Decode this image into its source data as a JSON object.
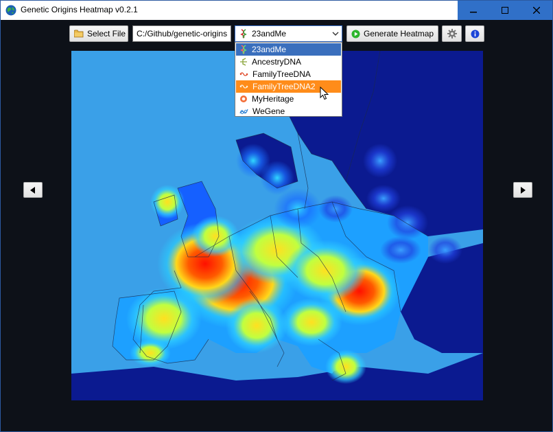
{
  "window": {
    "title": "Genetic Origins Heatmap v0.2.1",
    "icon": "globe-icon",
    "controls": [
      "minimize-icon",
      "maximize-icon",
      "close-icon"
    ]
  },
  "toolbar": {
    "select_file_label": "Select File",
    "file_path": "C:/Github/genetic-origins",
    "provider_selected": "23andMe",
    "generate_label": "Generate Heatmap",
    "settings_icon": "gear-icon",
    "info_icon": "info-icon"
  },
  "provider_dropdown": {
    "items": [
      {
        "label": "23andMe",
        "icon": "23andme-dna-icon",
        "state": "selected"
      },
      {
        "label": "AncestryDNA",
        "icon": "ancestry-leaf-icon",
        "state": "normal"
      },
      {
        "label": "FamilyTreeDNA",
        "icon": "ftdna-icon",
        "state": "normal"
      },
      {
        "label": "FamilyTreeDNA2",
        "icon": "ftdna-icon",
        "state": "hover"
      },
      {
        "label": "MyHeritage",
        "icon": "myheritage-icon",
        "state": "normal"
      },
      {
        "label": "WeGene",
        "icon": "wegene-icon",
        "state": "normal"
      }
    ]
  },
  "navigation": {
    "prev_icon": "arrow-left-icon",
    "next_icon": "arrow-right-icon"
  },
  "heatmap": {
    "region": "Europe",
    "colors": {
      "ocean": "#3aa0e8",
      "land_cold": "#0a1a8a",
      "mid": "#1aa0ff",
      "warm": "#ffe020",
      "hot": "#ff1010"
    }
  },
  "colors": {
    "title_bar_controls": "#3070c8",
    "dropdown_selected": "#3a6fbd",
    "dropdown_hover": "#ff8c1a",
    "window_background": "#0d1118"
  }
}
